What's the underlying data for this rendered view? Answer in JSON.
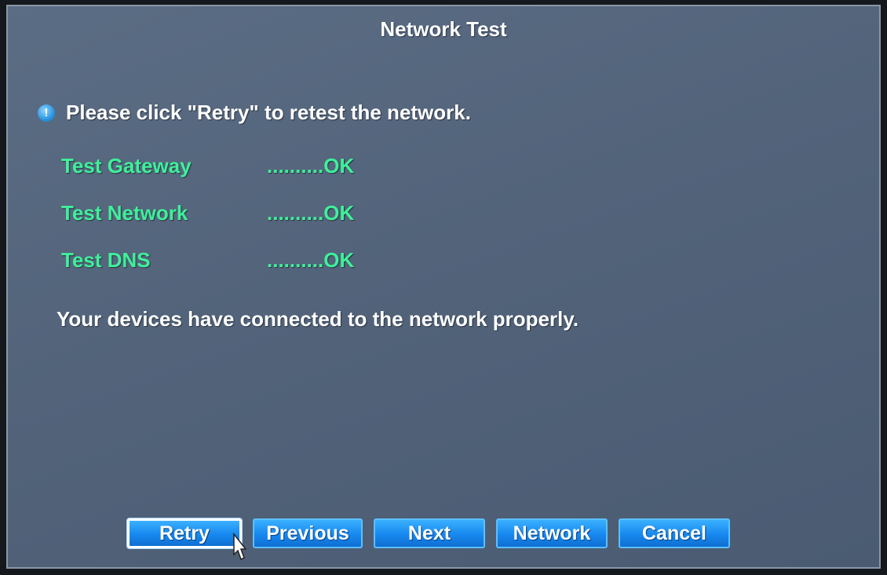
{
  "dialog": {
    "title": "Network Test",
    "notice_icon": "info-icon",
    "notice_icon_glyph": "!",
    "notice_text": "Please click \"Retry\" to retest the network.",
    "tests": [
      {
        "label": "Test Gateway",
        "result": "..........OK"
      },
      {
        "label": "Test Network",
        "result": "..........OK"
      },
      {
        "label": "Test DNS",
        "result": "..........OK"
      }
    ],
    "summary": "Your devices have connected to the network properly."
  },
  "buttons": {
    "retry": "Retry",
    "previous": "Previous",
    "next": "Next",
    "network": "Network",
    "cancel": "Cancel"
  },
  "colors": {
    "background": "#52637a",
    "test_text": "#3ff09a",
    "button": "#1788ef",
    "text": "#ffffff"
  }
}
